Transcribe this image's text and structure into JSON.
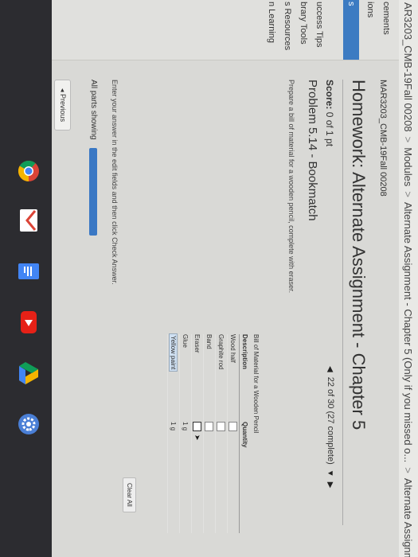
{
  "breadcrumb": {
    "items": [
      "AR3203_CMB-19Fall 00208",
      "Modules",
      "Alternate Assignment - Chapter 5 (Only if you missed o...",
      "Alternate Assignment -"
    ],
    "separator": ">"
  },
  "sidebar": {
    "items": [
      {
        "label": "cements"
      },
      {
        "label": "ions"
      },
      {
        "label": "s"
      },
      {
        "label": "uccess Tips"
      },
      {
        "label": "brary Tools"
      },
      {
        "label": "s Resources"
      },
      {
        "label": "n Learning"
      }
    ]
  },
  "main": {
    "course": "MAR3203_CMB-19Fall 00208",
    "title": "Homework: Alternate Assignment - Chapter 5",
    "score_label": "Score:",
    "score_value": "0 of 1 pt",
    "nav_text": "22 of 30 (27 complete)",
    "problem": "Problem 5.14 - Bookmatch",
    "instructions": "Prepare a bill of material for a wooden pencil, complete with eraser.",
    "bom": {
      "title": "Bill of Material for a Wooden Pencil",
      "headers": [
        "Description",
        "Quantity"
      ],
      "rows": [
        {
          "desc": "Wood half",
          "qty": ""
        },
        {
          "desc": "Graphite rod",
          "qty": ""
        },
        {
          "desc": "Band",
          "qty": ""
        },
        {
          "desc": "Eraser",
          "qty": ""
        },
        {
          "desc": "Glue",
          "qty": "1 g"
        },
        {
          "desc": "Yellow paint",
          "qty": "1 g"
        }
      ]
    },
    "clear_all": "Clear All",
    "enter_text": "Enter your answer in the edit fields and then click Check Answer.",
    "parts_text": "All parts showing",
    "previous": "Previous",
    "previous_icon": "◂"
  },
  "shelf": {
    "apps": [
      "chrome-icon",
      "gmail-icon",
      "docs-icon",
      "youtube-icon",
      "drive-icon",
      "settings-icon"
    ]
  },
  "colors": {
    "accent": "#3a78c4",
    "sidebar_active": "#3c7bc2"
  }
}
